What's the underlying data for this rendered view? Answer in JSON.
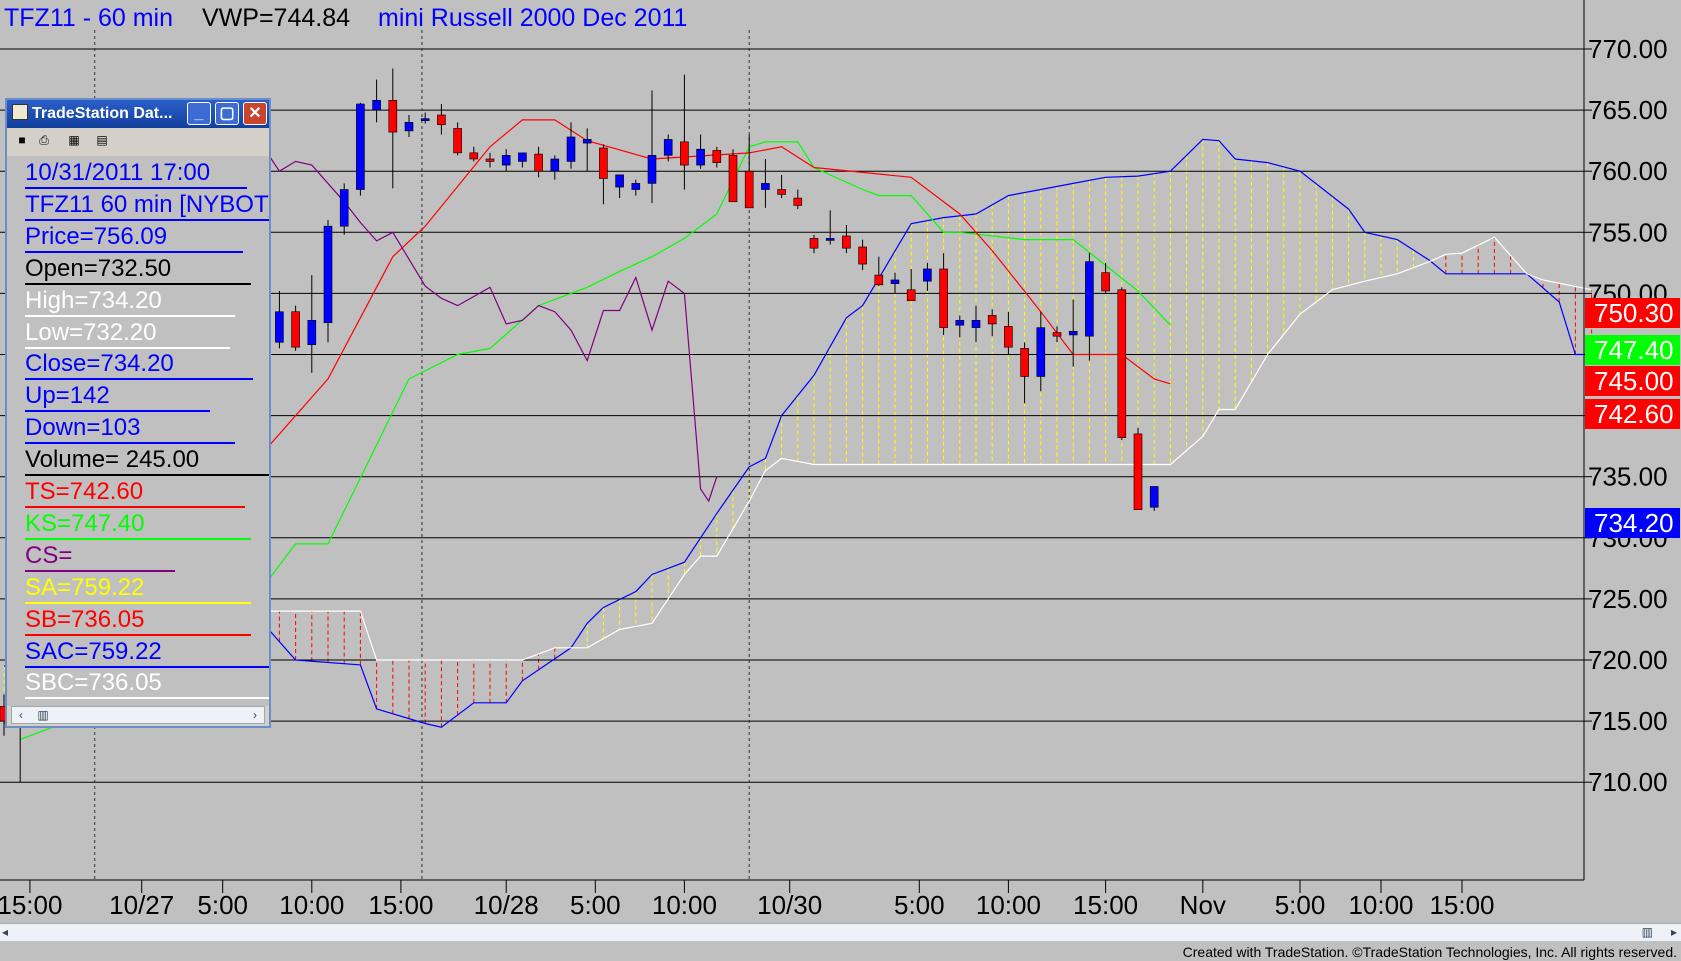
{
  "title": {
    "symbol": "TFZ11 - 60 min",
    "vwp": "VWP=744.84",
    "name": "mini Russell 2000 Dec 2011"
  },
  "colors": {
    "background": "#c0c0c0",
    "up_candle": "#0000ff",
    "down_candle": "#ff0000",
    "tenkan": "#ff0000",
    "kijun": "#00ff00",
    "chikou": "#800080",
    "span_a": "#0000ff",
    "span_b": "#ffffff",
    "cloud_bull": "#ffff00",
    "cloud_bear": "#ff0000"
  },
  "data_window": {
    "title": "TradeStation Dat...",
    "fields": [
      {
        "text": "10/31/2011 17:00",
        "color": "#0000ff"
      },
      {
        "text": "TFZ11 60 min [NYBOT]",
        "color": "#0000ff"
      },
      {
        "text": "Price=756.09",
        "color": "#0000ff"
      },
      {
        "text": "Open=732.50",
        "color": "#000000"
      },
      {
        "text": "High=734.20",
        "color": "#ffffff"
      },
      {
        "text": "Low=732.20",
        "color": "#ffffff"
      },
      {
        "text": "Close=734.20",
        "color": "#0000ff"
      },
      {
        "text": "Up=142",
        "color": "#0000ff"
      },
      {
        "text": "Down=103",
        "color": "#0000ff"
      },
      {
        "text": "Volume= 245.00",
        "color": "#000000"
      },
      {
        "text": "TS=742.60",
        "color": "#ff0000"
      },
      {
        "text": "KS=747.40",
        "color": "#00ff00"
      },
      {
        "text": "CS=",
        "color": "#800080"
      },
      {
        "text": "SA=759.22",
        "color": "#ffff00"
      },
      {
        "text": "SB=736.05",
        "color": "#ff0000"
      },
      {
        "text": "SAC=759.22",
        "color": "#0000ff"
      },
      {
        "text": "SBC=736.05",
        "color": "#ffffff"
      }
    ]
  },
  "price_labels": [
    {
      "value": "750.30",
      "bg": "#ff0000"
    },
    {
      "value": "747.40",
      "bg": "#00ff00"
    },
    {
      "value": "745.00",
      "bg": "#ff0000"
    },
    {
      "value": "742.60",
      "bg": "#ff0000"
    },
    {
      "value": "734.20",
      "bg": "#0000ff"
    }
  ],
  "footer": "Created with TradeStation. ©TradeStation Technologies, Inc. All rights reserved.",
  "chart_data": {
    "type": "candlestick",
    "title": "TFZ11 - 60 min",
    "y_ticks": [
      710,
      715,
      720,
      725,
      730,
      735,
      740,
      745,
      750,
      755,
      760,
      765,
      770
    ],
    "y_tick_labels": [
      "710.00",
      "715.00",
      "720.00",
      "725.00",
      "730.00",
      "735.00",
      "740.00",
      "745.00",
      "750.00",
      "755.00",
      "760.00",
      "765.00",
      "770.00"
    ],
    "ylim": [
      705,
      772.8
    ],
    "grid": true,
    "x_tick_labels": [
      "15:00",
      "10/27",
      "5:00",
      "10:00",
      "15:00",
      "10/28",
      "5:00",
      "10:00",
      "10/30",
      "5:00",
      "10:00",
      "15:00",
      "Nov",
      "5:00",
      "10:00",
      "15:00"
    ],
    "x_tick_positions": [
      1.6,
      8.5,
      13.5,
      19,
      24.5,
      31,
      36.5,
      42,
      48.5,
      56.5,
      62,
      68,
      74,
      80,
      85,
      90
    ],
    "candles": [
      {
        "o": 716.2,
        "h": 717.2,
        "l": 713.8,
        "c": 715.0
      },
      {
        "o": 714.5,
        "h": 718.2,
        "l": 710.0,
        "c": 718.0
      },
      {
        "o": 740.0,
        "h": 748.0,
        "l": 739.5,
        "c": 748.0
      },
      {
        "o": 746.0,
        "h": 750.2,
        "l": 745.5,
        "c": 748.5
      },
      {
        "o": 748.5,
        "h": 749.0,
        "l": 745.3,
        "c": 745.6
      },
      {
        "o": 745.8,
        "h": 751.5,
        "l": 743.5,
        "c": 747.8
      },
      {
        "o": 747.6,
        "h": 756.0,
        "l": 746.0,
        "c": 755.5
      },
      {
        "o": 755.5,
        "h": 759.0,
        "l": 754.8,
        "c": 758.5
      },
      {
        "o": 758.5,
        "h": 765.6,
        "l": 758.0,
        "c": 765.5
      },
      {
        "o": 765.0,
        "h": 767.5,
        "l": 764.0,
        "c": 765.8
      },
      {
        "o": 765.8,
        "h": 768.4,
        "l": 758.6,
        "c": 763.2
      },
      {
        "o": 763.3,
        "h": 764.6,
        "l": 762.8,
        "c": 764.0
      },
      {
        "o": 764.2,
        "h": 764.8,
        "l": 763.9,
        "c": 764.3
      },
      {
        "o": 764.6,
        "h": 765.5,
        "l": 763.0,
        "c": 763.8
      },
      {
        "o": 763.5,
        "h": 764.0,
        "l": 761.3,
        "c": 761.5
      },
      {
        "o": 761.5,
        "h": 762.0,
        "l": 760.8,
        "c": 761.0
      },
      {
        "o": 761.0,
        "h": 761.5,
        "l": 760.3,
        "c": 760.8
      },
      {
        "o": 760.5,
        "h": 761.8,
        "l": 760.0,
        "c": 761.3
      },
      {
        "o": 760.8,
        "h": 761.5,
        "l": 760.3,
        "c": 761.5
      },
      {
        "o": 761.4,
        "h": 762.0,
        "l": 759.5,
        "c": 760.0
      },
      {
        "o": 760.0,
        "h": 761.3,
        "l": 759.3,
        "c": 761.0
      },
      {
        "o": 760.8,
        "h": 764.0,
        "l": 760.2,
        "c": 762.8
      },
      {
        "o": 762.3,
        "h": 763.5,
        "l": 760.0,
        "c": 762.6
      },
      {
        "o": 761.9,
        "h": 762.2,
        "l": 757.3,
        "c": 759.4
      },
      {
        "o": 758.7,
        "h": 759.6,
        "l": 757.8,
        "c": 759.7
      },
      {
        "o": 758.5,
        "h": 759.3,
        "l": 758.0,
        "c": 759.0
      },
      {
        "o": 759.0,
        "h": 766.6,
        "l": 757.4,
        "c": 761.3
      },
      {
        "o": 761.3,
        "h": 763.0,
        "l": 760.8,
        "c": 762.6
      },
      {
        "o": 762.4,
        "h": 767.9,
        "l": 758.5,
        "c": 760.5
      },
      {
        "o": 760.5,
        "h": 763.0,
        "l": 760.2,
        "c": 761.8
      },
      {
        "o": 761.7,
        "h": 762.0,
        "l": 760.3,
        "c": 760.7
      },
      {
        "o": 761.3,
        "h": 761.8,
        "l": 758.8,
        "c": 757.5
      },
      {
        "o": 760.0,
        "h": 763.0,
        "l": 757.0,
        "c": 757.0
      },
      {
        "o": 758.5,
        "h": 761.0,
        "l": 757.0,
        "c": 759.0
      },
      {
        "o": 758.5,
        "h": 759.7,
        "l": 757.8,
        "c": 758.1
      },
      {
        "o": 757.8,
        "h": 758.5,
        "l": 756.9,
        "c": 757.2
      },
      {
        "o": 754.5,
        "h": 754.8,
        "l": 753.3,
        "c": 753.7
      },
      {
        "o": 754.5,
        "h": 756.8,
        "l": 754.0,
        "c": 754.5
      },
      {
        "o": 754.7,
        "h": 755.6,
        "l": 753.3,
        "c": 753.7
      },
      {
        "o": 753.8,
        "h": 754.4,
        "l": 751.9,
        "c": 752.4
      },
      {
        "o": 751.5,
        "h": 753.0,
        "l": 750.6,
        "c": 750.7
      },
      {
        "o": 750.8,
        "h": 751.7,
        "l": 750.0,
        "c": 751.1
      },
      {
        "o": 750.3,
        "h": 752.0,
        "l": 749.5,
        "c": 749.4
      },
      {
        "o": 751.0,
        "h": 752.5,
        "l": 750.2,
        "c": 752.0
      },
      {
        "o": 752.0,
        "h": 753.3,
        "l": 746.6,
        "c": 747.2
      },
      {
        "o": 747.4,
        "h": 748.2,
        "l": 746.4,
        "c": 747.8
      },
      {
        "o": 747.2,
        "h": 749.0,
        "l": 746.0,
        "c": 747.8
      },
      {
        "o": 748.2,
        "h": 748.7,
        "l": 746.5,
        "c": 747.5
      },
      {
        "o": 747.3,
        "h": 748.5,
        "l": 745.0,
        "c": 745.6
      },
      {
        "o": 745.5,
        "h": 746.0,
        "l": 741.0,
        "c": 743.2
      },
      {
        "o": 743.2,
        "h": 748.5,
        "l": 742.0,
        "c": 747.2
      },
      {
        "o": 746.8,
        "h": 747.3,
        "l": 746.0,
        "c": 746.5
      },
      {
        "o": 746.6,
        "h": 749.5,
        "l": 744.0,
        "c": 746.9
      },
      {
        "o": 746.5,
        "h": 753.3,
        "l": 744.5,
        "c": 752.6
      },
      {
        "o": 751.7,
        "h": 752.5,
        "l": 750.0,
        "c": 750.2
      },
      {
        "o": 750.3,
        "h": 750.5,
        "l": 738.0,
        "c": 738.2
      },
      {
        "o": 738.5,
        "h": 739.0,
        "l": 732.3,
        "c": 732.3
      },
      {
        "o": 732.5,
        "h": 734.2,
        "l": 732.2,
        "c": 734.2
      }
    ],
    "candle_x_index": [
      0,
      1,
      16,
      17,
      18,
      19,
      20,
      21,
      22,
      23,
      24,
      25,
      26,
      27,
      28,
      29,
      30,
      31,
      32,
      33,
      34,
      35,
      36,
      37,
      38,
      39,
      40,
      41,
      42,
      43,
      44,
      45,
      46,
      47,
      48,
      49,
      50,
      51,
      52,
      53,
      54,
      55,
      56,
      57,
      58,
      59,
      60,
      61,
      62,
      63,
      64,
      65,
      66,
      67,
      68,
      69,
      70,
      71
    ],
    "tenkan_sen": [
      [
        0,
        714.8
      ],
      [
        6,
        716.0
      ],
      [
        16,
        737.0
      ],
      [
        20,
        743.0
      ],
      [
        24,
        753.0
      ],
      [
        26,
        755.5
      ],
      [
        30,
        762.0
      ],
      [
        32,
        764.2
      ],
      [
        34,
        764.2
      ],
      [
        36,
        762.5
      ],
      [
        40,
        761.0
      ],
      [
        46,
        761.5
      ],
      [
        48,
        762.0
      ],
      [
        50,
        760.3
      ],
      [
        56,
        759.5
      ],
      [
        59,
        756.5
      ],
      [
        61,
        753.5
      ],
      [
        64,
        748.5
      ],
      [
        66,
        745.0
      ],
      [
        69,
        745.0
      ],
      [
        71,
        743.0
      ],
      [
        72,
        742.6
      ]
    ],
    "kijun_sen": [
      [
        1,
        713.5
      ],
      [
        6,
        716.0
      ],
      [
        8,
        720.0
      ],
      [
        12,
        724.0
      ],
      [
        14,
        726.0
      ],
      [
        16,
        726.0
      ],
      [
        18,
        729.5
      ],
      [
        20,
        729.5
      ],
      [
        25,
        743.0
      ],
      [
        28,
        745.0
      ],
      [
        30,
        745.5
      ],
      [
        33,
        749.0
      ],
      [
        36,
        750.5
      ],
      [
        38,
        751.8
      ],
      [
        40,
        753.0
      ],
      [
        42,
        754.5
      ],
      [
        44,
        756.5
      ],
      [
        46,
        762.0
      ],
      [
        47,
        762.4
      ],
      [
        49,
        762.4
      ],
      [
        50,
        760.3
      ],
      [
        53,
        758.5
      ],
      [
        54,
        758.0
      ],
      [
        56,
        758.0
      ],
      [
        58,
        755.0
      ],
      [
        59,
        755.0
      ],
      [
        63,
        754.4
      ],
      [
        66,
        754.4
      ],
      [
        70,
        750.2
      ],
      [
        72,
        747.4
      ]
    ],
    "chikou_span": [
      [
        15,
        763.0
      ],
      [
        16,
        762.0
      ],
      [
        17,
        760.0
      ],
      [
        18,
        760.8
      ],
      [
        19,
        760.5
      ],
      [
        21,
        757.5
      ],
      [
        22,
        755.8
      ],
      [
        23,
        754.3
      ],
      [
        24,
        755.0
      ],
      [
        26,
        750.6
      ],
      [
        27,
        749.6
      ],
      [
        28,
        749.0
      ],
      [
        30,
        750.5
      ],
      [
        31,
        747.5
      ],
      [
        32,
        747.8
      ],
      [
        33,
        749.0
      ],
      [
        34,
        748.5
      ],
      [
        35,
        747.0
      ],
      [
        36,
        744.5
      ],
      [
        37,
        748.6
      ],
      [
        38,
        748.6
      ],
      [
        39,
        751.3
      ],
      [
        40,
        747.0
      ],
      [
        41,
        751.0
      ],
      [
        42,
        750.0
      ],
      [
        43,
        734.0
      ],
      [
        43.5,
        733.0
      ],
      [
        44,
        735.0
      ]
    ],
    "senkou_a": [
      [
        0,
        719.5
      ],
      [
        5,
        720.0
      ],
      [
        6,
        721.0
      ],
      [
        8,
        721.0
      ],
      [
        10,
        722.3
      ],
      [
        16,
        723.0
      ],
      [
        18,
        720.0
      ],
      [
        22,
        719.6
      ],
      [
        23,
        716.0
      ],
      [
        26,
        714.8
      ],
      [
        27,
        714.5
      ],
      [
        29,
        716.5
      ],
      [
        31,
        716.5
      ],
      [
        32,
        718.3
      ],
      [
        35,
        721.0
      ],
      [
        36,
        723.0
      ],
      [
        37,
        724.3
      ],
      [
        39,
        725.6
      ],
      [
        40,
        727.0
      ],
      [
        42,
        728.0
      ],
      [
        44,
        732.0
      ],
      [
        46,
        735.8
      ],
      [
        47,
        736.5
      ],
      [
        48,
        740.0
      ],
      [
        50,
        743.3
      ],
      [
        52,
        748.0
      ],
      [
        53,
        749.0
      ],
      [
        56,
        755.7
      ],
      [
        58,
        756.2
      ],
      [
        60,
        756.5
      ],
      [
        62,
        758.0
      ],
      [
        64,
        758.5
      ],
      [
        66,
        759.0
      ],
      [
        68,
        759.5
      ],
      [
        70,
        759.6
      ],
      [
        72,
        760.0
      ],
      [
        74,
        762.6
      ],
      [
        75,
        762.5
      ],
      [
        76,
        761.0
      ],
      [
        78,
        760.7
      ],
      [
        80,
        760.0
      ],
      [
        83,
        756.9
      ],
      [
        84,
        755.0
      ],
      [
        86,
        754.4
      ],
      [
        88,
        752.7
      ],
      [
        89,
        751.6
      ],
      [
        92,
        751.6
      ],
      [
        94,
        751.6
      ],
      [
        96,
        749.3
      ],
      [
        97,
        745.0
      ],
      [
        98,
        745.0
      ]
    ],
    "senkou_b": [
      [
        0,
        716.5
      ],
      [
        5,
        720.0
      ],
      [
        6,
        721.0
      ],
      [
        8,
        721.0
      ],
      [
        10,
        722.3
      ],
      [
        16,
        724.0
      ],
      [
        22,
        724.0
      ],
      [
        23,
        720.0
      ],
      [
        32,
        720.0
      ],
      [
        34,
        721.0
      ],
      [
        36,
        721.0
      ],
      [
        38,
        722.5
      ],
      [
        40,
        723.0
      ],
      [
        41,
        725.0
      ],
      [
        42,
        727.0
      ],
      [
        43,
        728.5
      ],
      [
        44,
        728.5
      ],
      [
        46,
        733.0
      ],
      [
        47,
        735.5
      ],
      [
        48,
        736.5
      ],
      [
        50,
        736.0
      ],
      [
        72,
        736.0
      ],
      [
        74,
        738.3
      ],
      [
        75,
        740.5
      ],
      [
        76,
        740.5
      ],
      [
        78,
        745.0
      ],
      [
        80,
        748.3
      ],
      [
        82,
        750.3
      ],
      [
        84,
        751.0
      ],
      [
        86,
        751.6
      ],
      [
        88,
        752.6
      ],
      [
        89,
        753.2
      ],
      [
        90,
        753.3
      ],
      [
        92,
        754.6
      ],
      [
        94,
        751.6
      ],
      [
        95,
        751.1
      ],
      [
        98,
        750.3
      ]
    ]
  }
}
